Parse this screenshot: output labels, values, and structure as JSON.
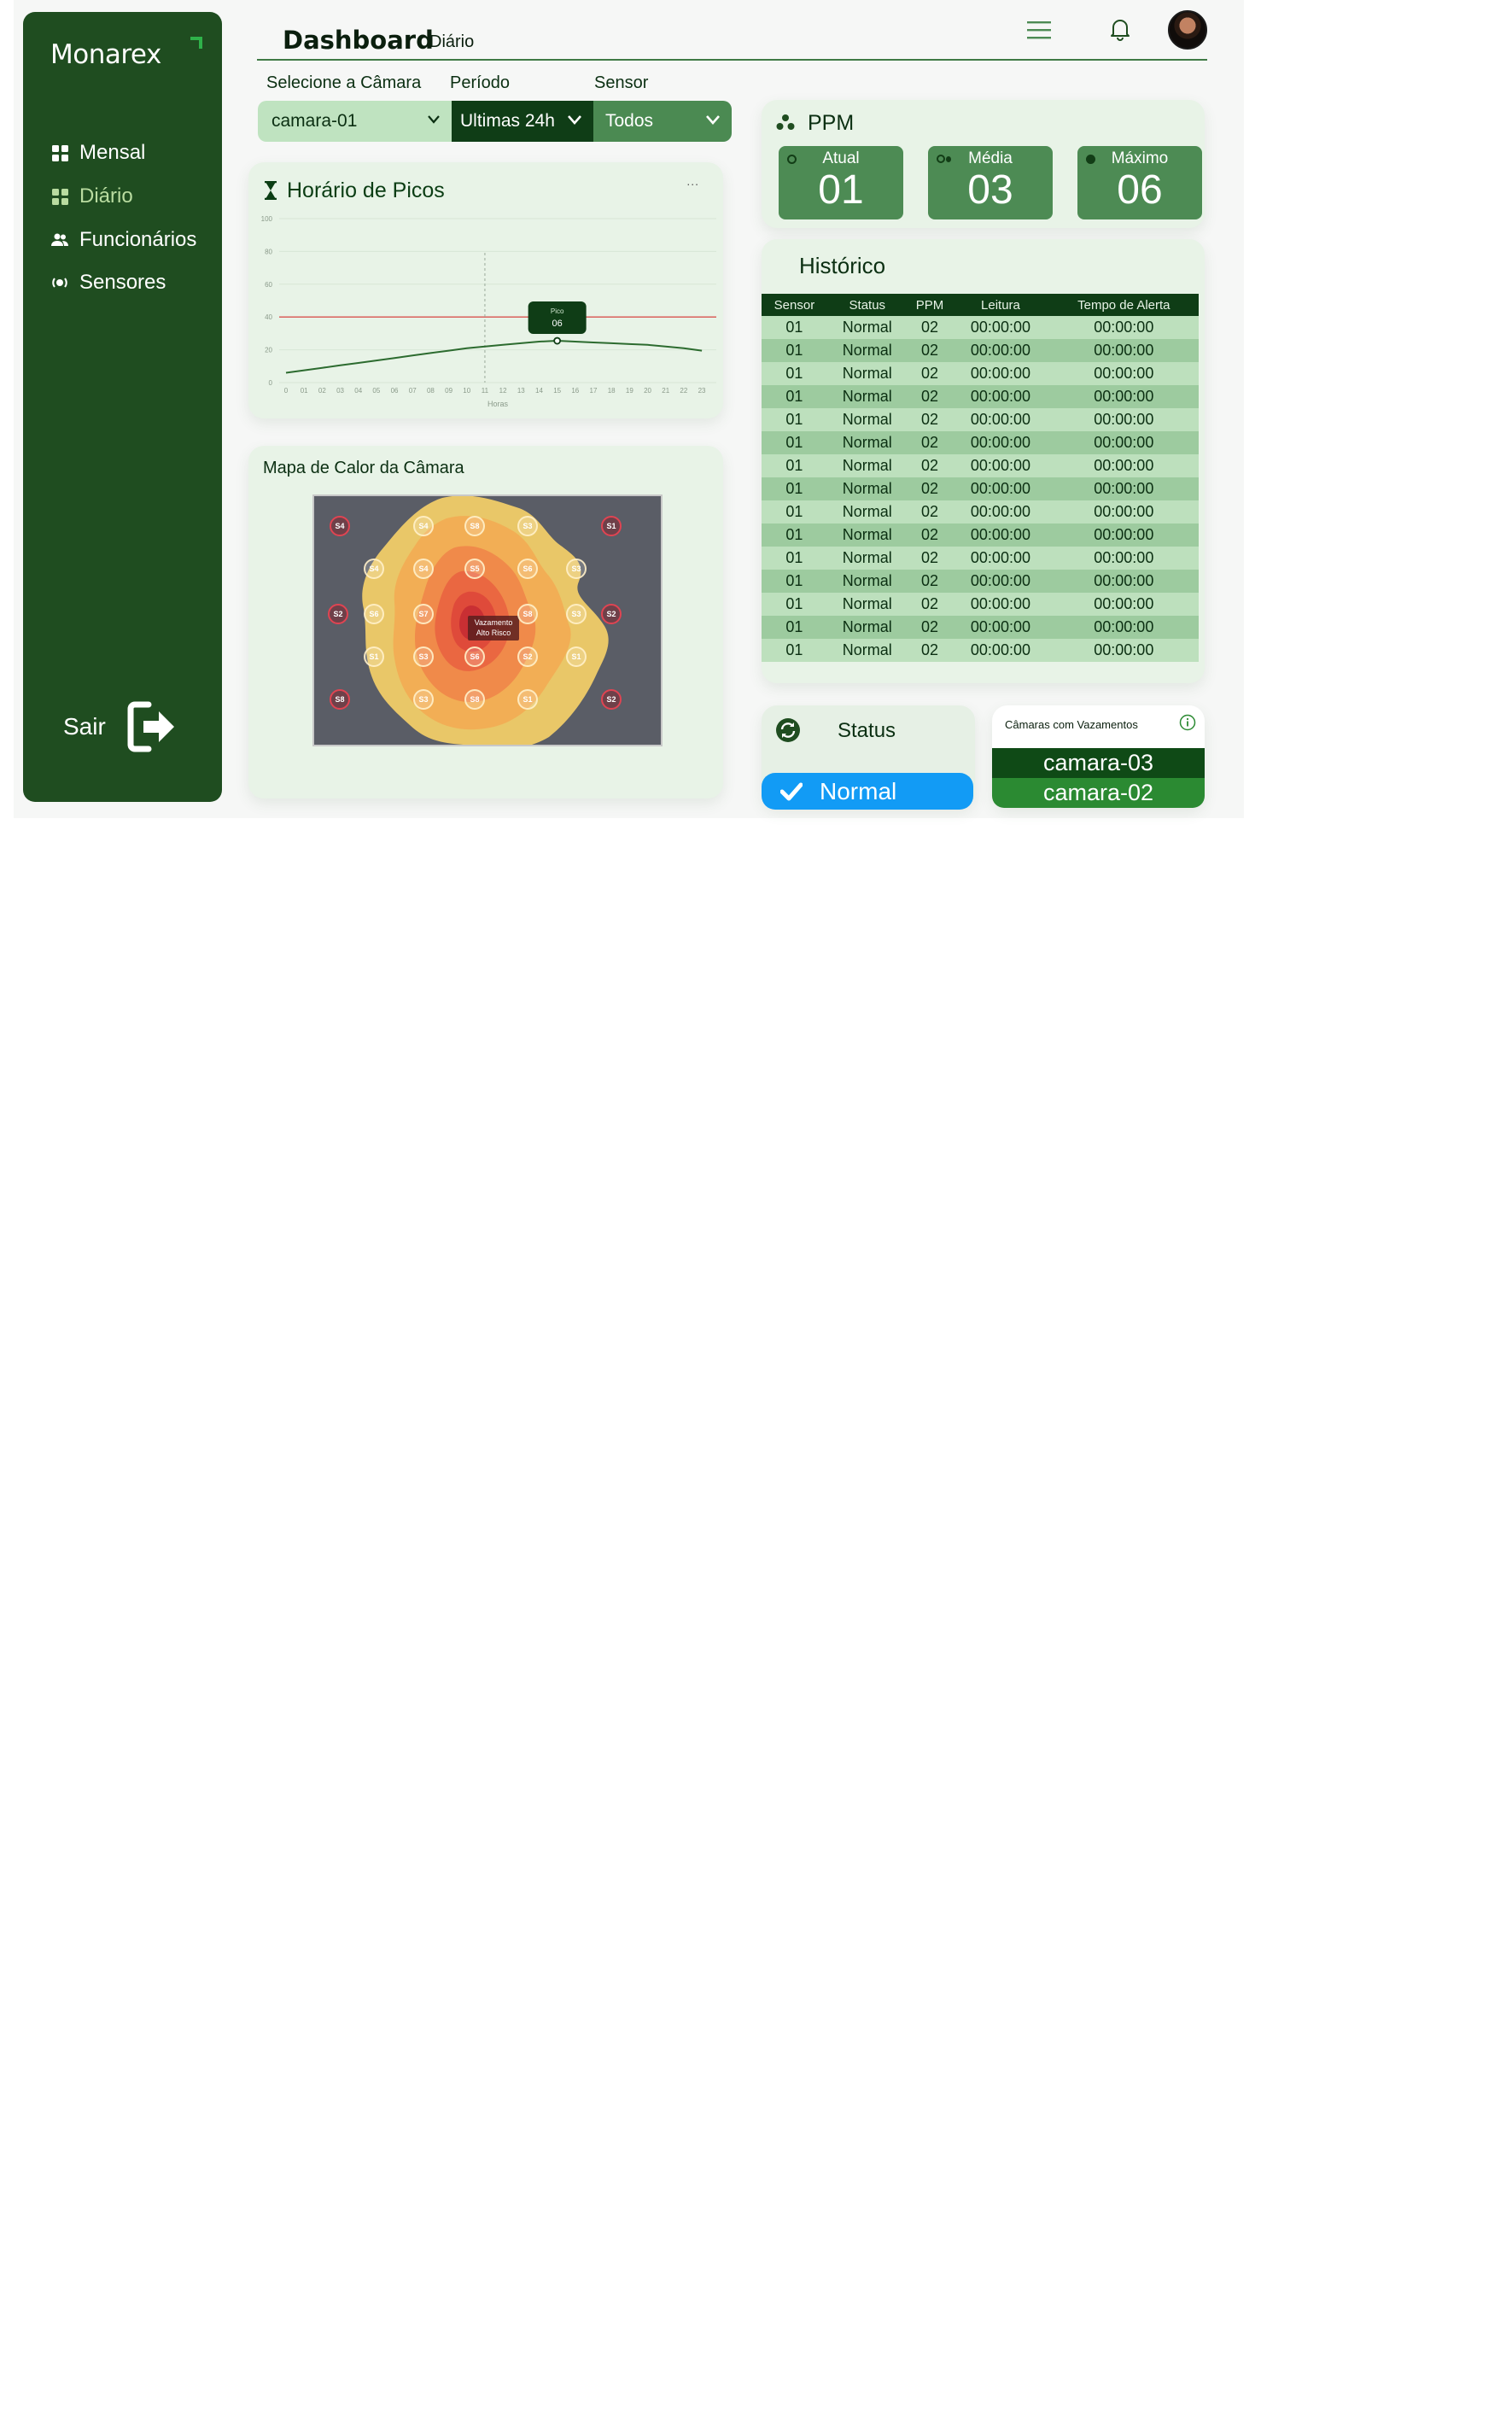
{
  "brand": {
    "name": "Monarex"
  },
  "sidebar": {
    "items": [
      {
        "label": "Mensal",
        "icon": "grid-icon"
      },
      {
        "label": "Diário",
        "icon": "grid-icon",
        "active": true
      },
      {
        "label": "Funcionários",
        "icon": "users-icon"
      },
      {
        "label": "Sensores",
        "icon": "sensor-icon"
      }
    ],
    "logout_label": "Sair"
  },
  "header": {
    "title": "Dashboard",
    "subtitle": "Diário"
  },
  "filters": {
    "camera": {
      "label": "Selecione a Câmara",
      "value": "camara-01"
    },
    "period": {
      "label": "Período",
      "value": "Ultimas 24h"
    },
    "sensor": {
      "label": "Sensor",
      "value": "Todos"
    }
  },
  "peaks": {
    "title": "Horário de Picos",
    "more": "...",
    "chart_data": {
      "type": "line",
      "xlabel": "Horas",
      "ylabel": "",
      "x": [
        "0",
        "01",
        "02",
        "03",
        "04",
        "05",
        "06",
        "07",
        "08",
        "09",
        "10",
        "11",
        "12",
        "13",
        "14",
        "15",
        "16",
        "17",
        "18",
        "19",
        "20",
        "21",
        "22",
        "23"
      ],
      "series": [
        {
          "values": [
            6,
            7.5,
            9,
            10.5,
            12,
            13.5,
            15,
            16.5,
            18,
            19.5,
            21,
            22,
            23,
            24,
            25,
            25.5,
            25,
            24.5,
            24,
            23.5,
            23,
            22,
            21,
            19.5
          ]
        }
      ],
      "threshold": 40,
      "yticks": [
        "0",
        "20",
        "40",
        "60",
        "80",
        "100"
      ],
      "ylim": [
        0,
        100
      ],
      "tooltip": {
        "label": "Pico",
        "value": "06"
      },
      "highlight_x": "15"
    }
  },
  "heatmap": {
    "title": "Mapa de Calor da Câmara",
    "tooltip": [
      "Vazamento",
      "Alto Risco"
    ],
    "sensors": [
      {
        "label": "S4",
        "style": "red"
      },
      {
        "label": "S4",
        "style": "light"
      },
      {
        "label": "S8",
        "style": "light"
      },
      {
        "label": "S3",
        "style": "light"
      },
      {
        "label": "S1",
        "style": "red"
      },
      {
        "label": "S4",
        "style": "light"
      },
      {
        "label": "S4",
        "style": "light"
      },
      {
        "label": "S5",
        "style": "light"
      },
      {
        "label": "S6",
        "style": "light"
      },
      {
        "label": "S3",
        "style": "light"
      },
      {
        "label": "S2",
        "style": "red"
      },
      {
        "label": "S6",
        "style": "light"
      },
      {
        "label": "S7",
        "style": "light"
      },
      {
        "label": "S8",
        "style": "light"
      },
      {
        "label": "S3",
        "style": "light"
      },
      {
        "label": "S2",
        "style": "red"
      },
      {
        "label": "S1",
        "style": "light"
      },
      {
        "label": "S3",
        "style": "light"
      },
      {
        "label": "S6",
        "style": "light"
      },
      {
        "label": "S2",
        "style": "light"
      },
      {
        "label": "S1",
        "style": "light"
      },
      {
        "label": "S8",
        "style": "red"
      },
      {
        "label": "S3",
        "style": "light"
      },
      {
        "label": "S8",
        "style": "light"
      },
      {
        "label": "S1",
        "style": "light"
      },
      {
        "label": "S2",
        "style": "red"
      }
    ]
  },
  "ppm": {
    "title": "PPM",
    "atual": {
      "label": "Atual",
      "value": "01"
    },
    "media": {
      "label": "Média",
      "value": "03"
    },
    "maximo": {
      "label": "Máximo",
      "value": "06"
    }
  },
  "history": {
    "title": "Histórico",
    "columns": [
      "Sensor",
      "Status",
      "PPM",
      "Leitura",
      "Tempo de Alerta"
    ],
    "rows": [
      [
        "01",
        "Normal",
        "02",
        "00:00:00",
        "00:00:00"
      ],
      [
        "01",
        "Normal",
        "02",
        "00:00:00",
        "00:00:00"
      ],
      [
        "01",
        "Normal",
        "02",
        "00:00:00",
        "00:00:00"
      ],
      [
        "01",
        "Normal",
        "02",
        "00:00:00",
        "00:00:00"
      ],
      [
        "01",
        "Normal",
        "02",
        "00:00:00",
        "00:00:00"
      ],
      [
        "01",
        "Normal",
        "02",
        "00:00:00",
        "00:00:00"
      ],
      [
        "01",
        "Normal",
        "02",
        "00:00:00",
        "00:00:00"
      ],
      [
        "01",
        "Normal",
        "02",
        "00:00:00",
        "00:00:00"
      ],
      [
        "01",
        "Normal",
        "02",
        "00:00:00",
        "00:00:00"
      ],
      [
        "01",
        "Normal",
        "02",
        "00:00:00",
        "00:00:00"
      ],
      [
        "01",
        "Normal",
        "02",
        "00:00:00",
        "00:00:00"
      ],
      [
        "01",
        "Normal",
        "02",
        "00:00:00",
        "00:00:00"
      ],
      [
        "01",
        "Normal",
        "02",
        "00:00:00",
        "00:00:00"
      ],
      [
        "01",
        "Normal",
        "02",
        "00:00:00",
        "00:00:00"
      ],
      [
        "01",
        "Normal",
        "02",
        "00:00:00",
        "00:00:00"
      ]
    ]
  },
  "status": {
    "title": "Status",
    "value": "Normal"
  },
  "leaks": {
    "title": "Câmaras com Vazamentos",
    "items": [
      "camara-03",
      "camara-02"
    ]
  },
  "colors": {
    "sidebar": "#1f4d20",
    "accent": "#4d8b54",
    "status": "#129bf5",
    "threshold": "#d9534f",
    "line": "#2c6b2f"
  }
}
